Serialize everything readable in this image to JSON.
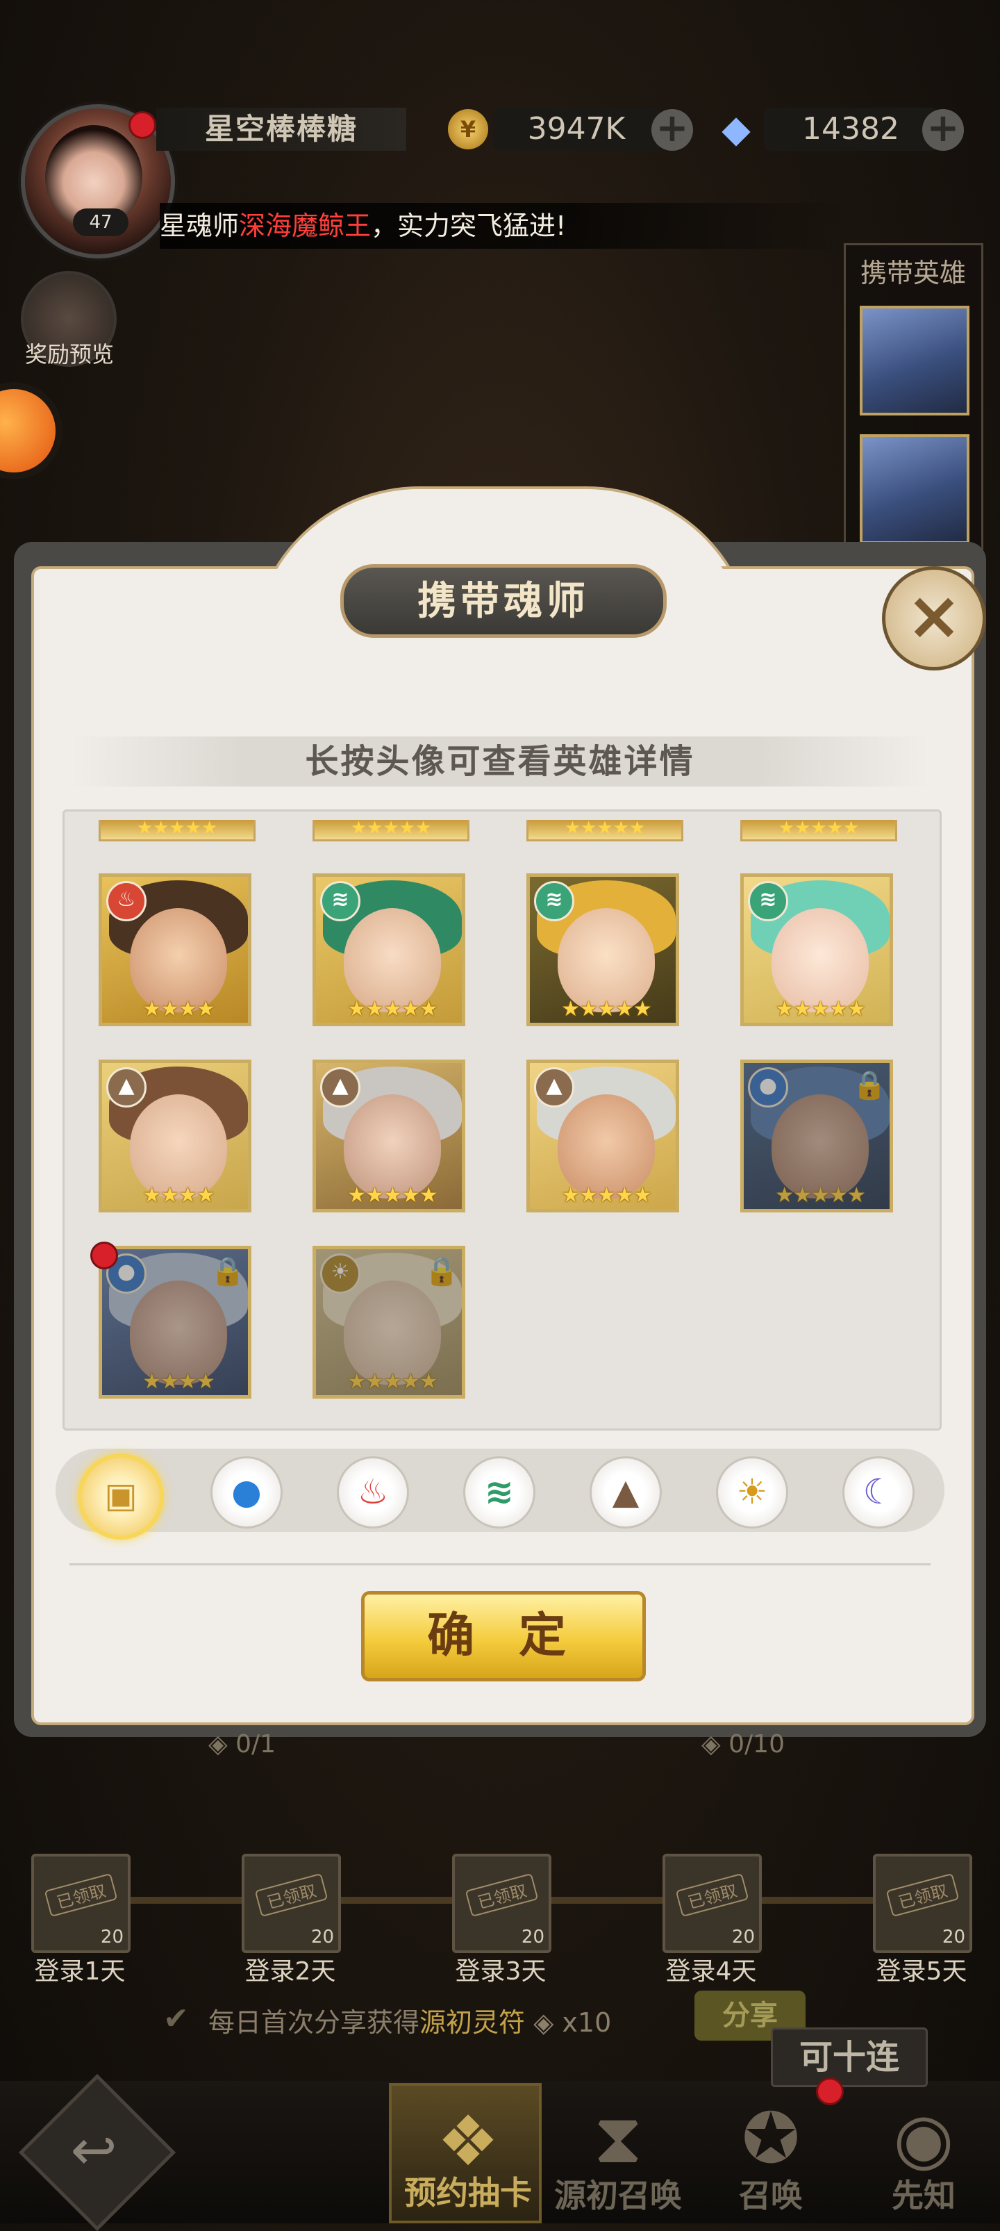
{
  "player": {
    "name": "星空棒棒糖",
    "level": "47",
    "gold": "3947K",
    "diamonds": "14382"
  },
  "ticker": {
    "prefix": "星魂师",
    "highlight": "深海魔鲸王",
    "suffix": "，实力突飞猛进!"
  },
  "sidebar": {
    "reward_preview_label": "奖励预览"
  },
  "carry_panel": {
    "title": "携带英雄"
  },
  "modal": {
    "title": "携带魂师",
    "subtitle": "长按头像可查看英雄详情",
    "confirm_label": "确 定",
    "heroes": [
      {
        "element": "fire",
        "stars": "★★★★",
        "locked": false
      },
      {
        "element": "wind",
        "stars": "★★★★★",
        "locked": false
      },
      {
        "element": "wind",
        "stars": "★★★★★",
        "locked": false
      },
      {
        "element": "wind",
        "stars": "★★★★★",
        "locked": false
      },
      {
        "element": "earth",
        "stars": "★★★★",
        "locked": false
      },
      {
        "element": "earth",
        "stars": "★★★★★",
        "locked": false
      },
      {
        "element": "earth",
        "stars": "★★★★★",
        "locked": false
      },
      {
        "element": "water",
        "stars": "★★★★★",
        "locked": true
      },
      {
        "element": "water",
        "stars": "★★★★",
        "locked": true
      },
      {
        "element": "light",
        "stars": "★★★★★",
        "locked": true
      }
    ],
    "partial_stars": "★★★★★",
    "filters": [
      "all",
      "water",
      "fire",
      "wind",
      "earth",
      "light",
      "dark"
    ]
  },
  "progress": {
    "left_counter": "0/1",
    "right_counter": "0/10"
  },
  "login_rewards": [
    {
      "stamp": "已领取",
      "qty": "20",
      "label": "登录1天"
    },
    {
      "stamp": "已领取",
      "qty": "20",
      "label": "登录2天"
    },
    {
      "stamp": "已领取",
      "qty": "20",
      "label": "登录3天"
    },
    {
      "stamp": "已领取",
      "qty": "20",
      "label": "登录4天"
    },
    {
      "stamp": "已领取",
      "qty": "20",
      "label": "登录5天"
    }
  ],
  "share": {
    "prefix": "每日首次分享获得",
    "highlight": "源初灵符",
    "qty": "x10",
    "button_label": "分享"
  },
  "bottom_nav": {
    "ten_pull_tag": "可十连",
    "items": [
      {
        "label": "预约抽卡"
      },
      {
        "label": "源初召唤"
      },
      {
        "label": "召唤"
      },
      {
        "label": "先知"
      }
    ]
  },
  "colors": {
    "gold_accent": "#c6ab7d",
    "confirm_yellow": "#f4cc3d",
    "ticker_red": "#ff3f3a",
    "star_yellow": "#ffd54a"
  }
}
